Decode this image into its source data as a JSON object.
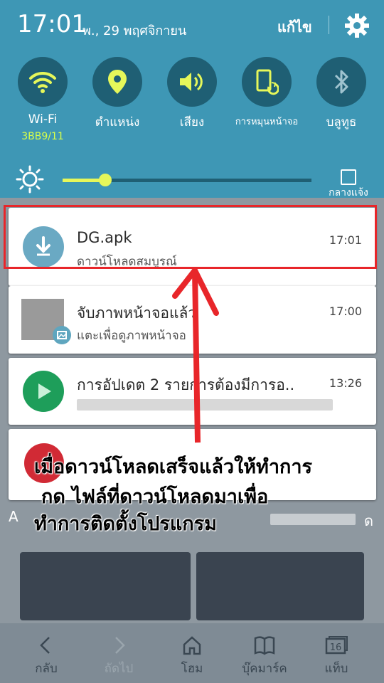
{
  "status_bar": {
    "time": "17:01",
    "date": "พ., 29 พฤศจิกายน",
    "edit_label": "แก้ไข"
  },
  "quick_settings": [
    {
      "label": "Wi-Fi",
      "sub": "3BB9/11",
      "icon": "wifi-icon"
    },
    {
      "label": "ตำแหน่ง",
      "icon": "location-icon"
    },
    {
      "label": "เสียง",
      "icon": "volume-icon"
    },
    {
      "label": "การหมุนหน้าจอ",
      "icon": "rotate-icon"
    },
    {
      "label": "บลูทูธ",
      "icon": "bluetooth-icon"
    }
  ],
  "brightness": {
    "level": 0.17,
    "night_label": "กลางแจ้ง"
  },
  "notifications": [
    {
      "title": "DG.apk",
      "subtitle": "ดาวน์โหลดสมบูรณ์",
      "time": "17:01",
      "icon": "download-icon"
    },
    {
      "title": "จับภาพหน้าจอแล้ว",
      "subtitle": "แตะเพื่อดูภาพหน้าจอ",
      "time": "17:00",
      "icon": "screenshot-thumbnail"
    },
    {
      "title": "การอัปเดต 2 รายการต้องมีการอ..",
      "subtitle": "",
      "time": "13:26",
      "icon": "play-store-icon"
    }
  ],
  "annotation": {
    "lines": [
      "เมื่อดาวน์โหลดเสร็จแล้วให้ทำการ",
      "กด ไฟล์ที่ดาวน์โหลดมาเพื่อ",
      "ทำการติดตั้งโปรแกรม"
    ],
    "highlight_color": "#e8262a"
  },
  "partial_text": {
    "left": "A",
    "right": "ด"
  },
  "bottom_nav": [
    {
      "label": "กลับ",
      "icon": "back-icon"
    },
    {
      "label": "ถัดไป",
      "icon": "forward-icon"
    },
    {
      "label": "โฮม",
      "icon": "home-icon"
    },
    {
      "label": "บุ๊คมาร์ค",
      "icon": "bookmark-icon"
    },
    {
      "label": "แท็บ",
      "icon": "tabs-icon",
      "count": "16"
    }
  ]
}
